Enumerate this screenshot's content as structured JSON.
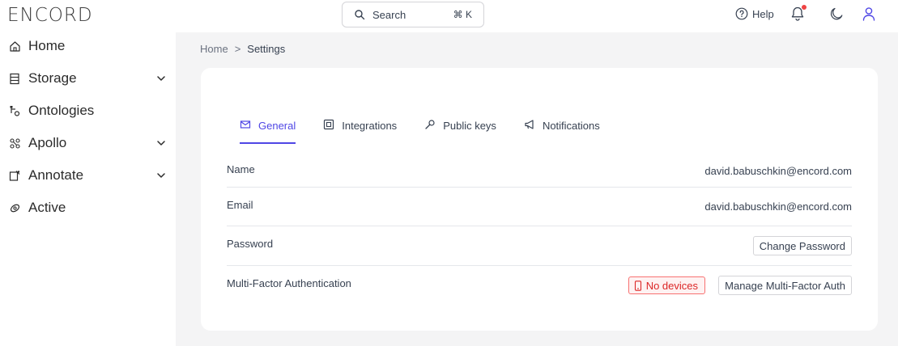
{
  "header": {
    "logo": "ENCORD",
    "search_label": "Search",
    "search_shortcut": "⌘ K",
    "help_label": "Help"
  },
  "sidebar": {
    "items": [
      {
        "label": "Home",
        "icon": "home-icon",
        "expandable": false
      },
      {
        "label": "Storage",
        "icon": "storage-icon",
        "expandable": true
      },
      {
        "label": "Ontologies",
        "icon": "ontology-icon",
        "expandable": false
      },
      {
        "label": "Apollo",
        "icon": "apollo-icon",
        "expandable": true
      },
      {
        "label": "Annotate",
        "icon": "annotate-icon",
        "expandable": true
      },
      {
        "label": "Active",
        "icon": "active-icon",
        "expandable": false
      }
    ]
  },
  "breadcrumb": {
    "home": "Home",
    "separator": ">",
    "current": "Settings"
  },
  "tabs": [
    {
      "label": "General",
      "icon": "mail-icon",
      "active": true
    },
    {
      "label": "Integrations",
      "icon": "integration-icon",
      "active": false
    },
    {
      "label": "Public keys",
      "icon": "key-icon",
      "active": false
    },
    {
      "label": "Notifications",
      "icon": "megaphone-icon",
      "active": false
    }
  ],
  "settings": {
    "name_label": "Name",
    "name_value": "david.babuschkin@encord.com",
    "email_label": "Email",
    "email_value": "david.babuschkin@encord.com",
    "password_label": "Password",
    "password_button": "Change Password",
    "mfa_label": "Multi-Factor Authentication",
    "mfa_badge": "No devices",
    "mfa_button": "Manage Multi-Factor Auth"
  },
  "colors": {
    "accent": "#4f46e5",
    "danger": "#dc2626",
    "notification_dot": "#ef4444",
    "main_background": "#f4f4f5"
  }
}
